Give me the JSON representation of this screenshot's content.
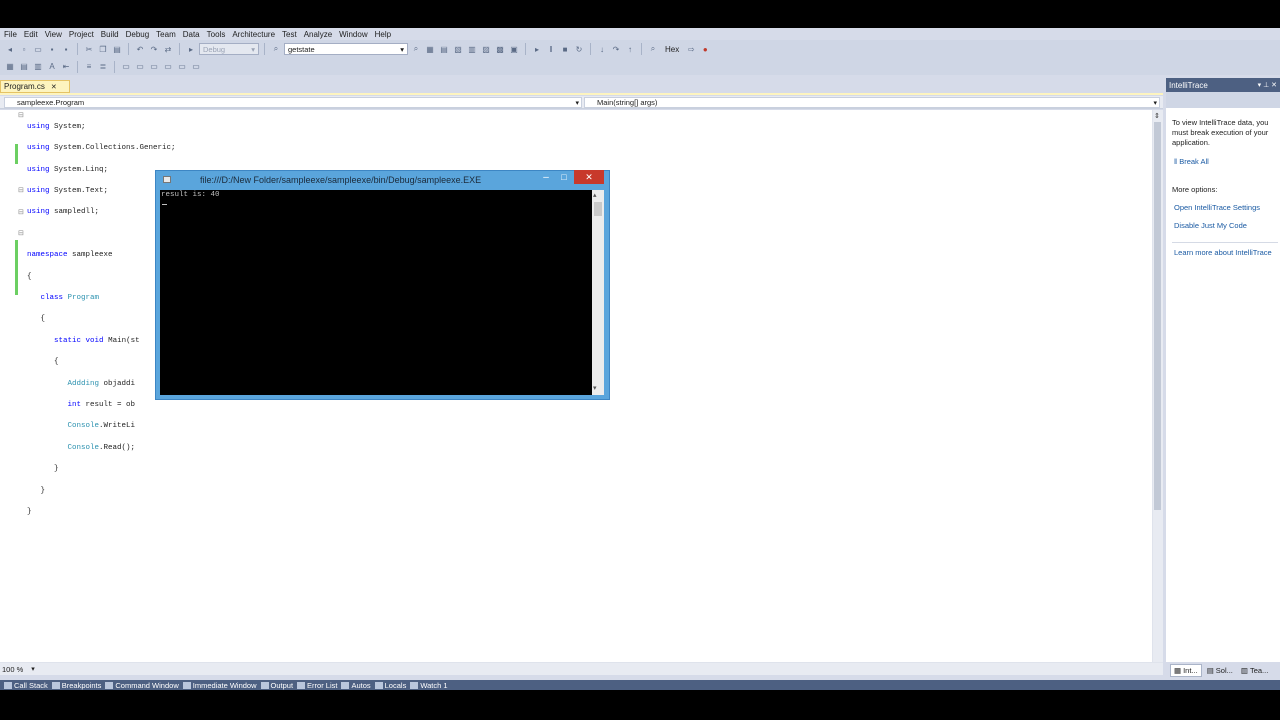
{
  "menu": [
    "File",
    "Edit",
    "View",
    "Project",
    "Build",
    "Debug",
    "Team",
    "Data",
    "Tools",
    "Architecture",
    "Test",
    "Analyze",
    "Window",
    "Help"
  ],
  "toolbar": {
    "config_combo": "Debug",
    "find_combo": "getstate",
    "hex_label": "Hex"
  },
  "editor": {
    "tab_label": "Program.cs",
    "tab_close": "✕",
    "nav_left": "sampleexe.Program",
    "nav_right": "Main(string[] args)",
    "zoom": "100 %",
    "code": {
      "l1": [
        "using",
        " System;"
      ],
      "l2": [
        "using",
        " System.Collections.Generic;"
      ],
      "l3": [
        "using",
        " System.Linq;"
      ],
      "l4": [
        "using",
        " System.Text;"
      ],
      "l5": [
        "using",
        " sampledll;"
      ],
      "l7": [
        "namespace",
        " sampleexe"
      ],
      "l8": "{",
      "l9": [
        "class",
        "Program"
      ],
      "l10": "{",
      "l11": [
        "static",
        "void",
        " Main(st"
      ],
      "l12": "{",
      "l13": [
        "Addding",
        " objaddi"
      ],
      "l14": [
        "int",
        " result = ob"
      ],
      "l15": [
        "Console",
        ".WriteLi"
      ],
      "l16": [
        "Console",
        ".Read();"
      ],
      "l17": "}",
      "l18": "}",
      "l19": "}"
    }
  },
  "console": {
    "title": "file:///D:/New Folder/sampleexe/sampleexe/bin/Debug/sampleexe.EXE",
    "output": "result is: 40",
    "min": "–",
    "max": "□",
    "close": "✕"
  },
  "intellitrace": {
    "title": "IntelliTrace",
    "header_icons": "▾ ⊥ ✕",
    "message": "To view IntelliTrace data, you must break execution of your application.",
    "break_all": "Break All",
    "more_options": "More options:",
    "open_settings": "Open IntelliTrace Settings",
    "disable_jmc": "Disable Just My Code",
    "learn_more": "Learn more about IntelliTrace",
    "tabs": [
      "Int...",
      "Sol...",
      "Tea..."
    ]
  },
  "bottom_tabs": [
    "Call Stack",
    "Breakpoints",
    "Command Window",
    "Immediate Window",
    "Output",
    "Error List",
    "Autos",
    "Locals",
    "Watch 1"
  ]
}
